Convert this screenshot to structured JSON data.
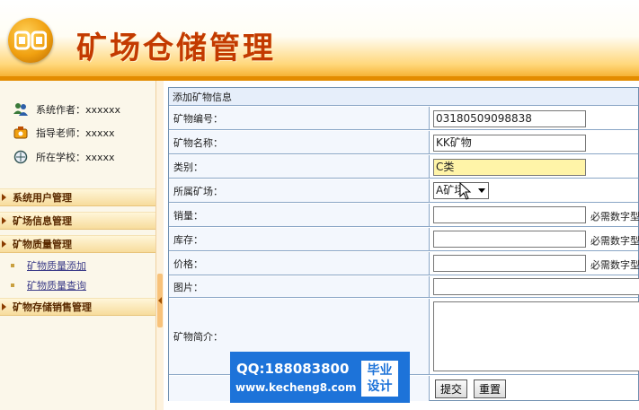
{
  "header": {
    "title": "矿场仓储管理"
  },
  "sidebar": {
    "info": [
      {
        "label": "系统作者：xxxxxx",
        "icon": "users-icon"
      },
      {
        "label": "指导老师：xxxxx",
        "icon": "teacher-icon"
      },
      {
        "label": "所在学校：xxxxx",
        "icon": "school-icon"
      }
    ],
    "menu": [
      {
        "label": "系统用户管理"
      },
      {
        "label": "矿场信息管理"
      },
      {
        "label": "矿物质量管理"
      },
      {
        "label": "矿物存储销售管理"
      }
    ],
    "sub_items": [
      {
        "label": "矿物质量添加"
      },
      {
        "label": "矿物质量查询"
      }
    ]
  },
  "form": {
    "caption": "添加矿物信息",
    "fields": {
      "code": {
        "label": "矿物编号：",
        "value": "03180509098838"
      },
      "name": {
        "label": "矿物名称：",
        "value": "KK矿物"
      },
      "category": {
        "label": "类别：",
        "value": "C类"
      },
      "mine": {
        "label": "所属矿场：",
        "value": "A矿场"
      },
      "sales": {
        "label": "销量：",
        "value": "",
        "hint": "必需数字型"
      },
      "stock": {
        "label": "库存：",
        "value": "",
        "hint": "必需数字型"
      },
      "price": {
        "label": "价格：",
        "value": "",
        "hint": "必需数字型"
      },
      "image": {
        "label": "图片："
      },
      "intro": {
        "label": "矿物简介："
      }
    },
    "submit_label": "提交",
    "reset_label": "重置"
  },
  "watermark": {
    "qq": "QQ:188083800",
    "url": "www.kecheng8.com",
    "badge_line1": "毕业",
    "badge_line2": "设计"
  }
}
